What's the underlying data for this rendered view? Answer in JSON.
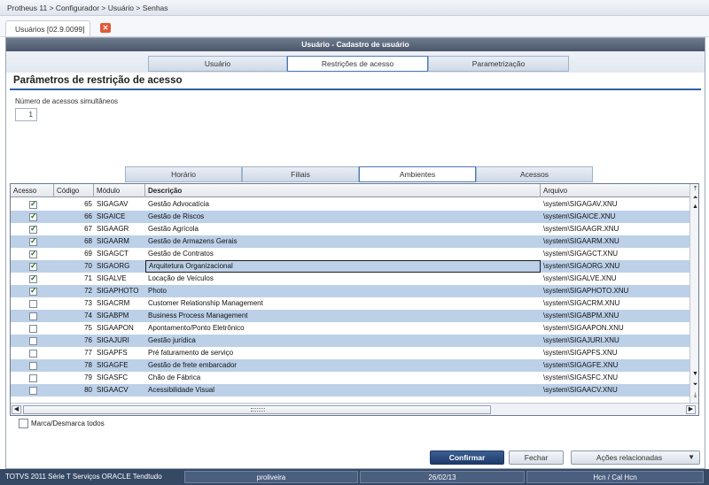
{
  "breadcrumb": "Protheus 11 > Configurador > Usuário > Senhas",
  "doc_tab": {
    "label": "Usuários [02.9.0099]",
    "close_icon": "close-icon"
  },
  "window": {
    "title": "Usuário - Cadastro de usuário"
  },
  "main_tabs": [
    {
      "label": "Usuário",
      "active": false
    },
    {
      "label": "Restrições de acesso",
      "active": true
    },
    {
      "label": "Parametrização",
      "active": false
    }
  ],
  "section": {
    "title": "Parâmetros de restrição de acesso",
    "field_label": "Número de acessos simultâneos",
    "field_value": "1"
  },
  "sub_tabs": [
    {
      "label": "Horário",
      "active": false
    },
    {
      "label": "Filiais",
      "active": false
    },
    {
      "label": "Ambientes",
      "active": true
    },
    {
      "label": "Acessos",
      "active": false
    }
  ],
  "grid": {
    "columns": [
      "Acesso",
      "Código",
      "Módulo",
      "Descrição",
      "Arquivo"
    ],
    "rows": [
      {
        "checked": true,
        "code": "65",
        "module": "SIGAGAV",
        "description": "Gestão Advocatícia",
        "file": "\\system\\SIGAGAV.XNU"
      },
      {
        "checked": true,
        "code": "66",
        "module": "SIGAICE",
        "description": "Gestão de Riscos",
        "file": "\\system\\SIGAICE.XNU"
      },
      {
        "checked": true,
        "code": "67",
        "module": "SIGAAGR",
        "description": "Gestão Agrícola",
        "file": "\\system\\SIGAAGR.XNU"
      },
      {
        "checked": true,
        "code": "68",
        "module": "SIGAARM",
        "description": "Gestão de Armazens Gerais",
        "file": "\\system\\SIGAARM.XNU"
      },
      {
        "checked": true,
        "code": "69",
        "module": "SIGAGCT",
        "description": "Gestão de Contratos",
        "file": "\\system\\SIGAGCT.XNU"
      },
      {
        "checked": true,
        "code": "70",
        "module": "SIGAORG",
        "description": "Arquitetura Organizacional",
        "file": "\\system\\SIGAORG.XNU"
      },
      {
        "checked": true,
        "code": "71",
        "module": "SIGALVE",
        "description": "Locação de Veículos",
        "file": "\\system\\SIGALVE.XNU"
      },
      {
        "checked": true,
        "code": "72",
        "module": "SIGAPHOTO",
        "description": "Photo",
        "file": "\\system\\SIGAPHOTO.XNU"
      },
      {
        "checked": false,
        "code": "73",
        "module": "SIGACRM",
        "description": "Customer Relationship Management",
        "file": "\\system\\SIGACRM.XNU"
      },
      {
        "checked": false,
        "code": "74",
        "module": "SIGABPM",
        "description": "Business Process Management",
        "file": "\\system\\SIGABPM.XNU"
      },
      {
        "checked": false,
        "code": "75",
        "module": "SIGAAPON",
        "description": "Apontamento/Ponto Eletrônico",
        "file": "\\system\\SIGAAPON.XNU"
      },
      {
        "checked": false,
        "code": "76",
        "module": "SIGAJURI",
        "description": "Gestão jurídica",
        "file": "\\system\\SIGAJURI.XNU"
      },
      {
        "checked": false,
        "code": "77",
        "module": "SIGAPFS",
        "description": "Pré faturamento de serviço",
        "file": "\\system\\SIGAPFS.XNU"
      },
      {
        "checked": false,
        "code": "78",
        "module": "SIGAGFE",
        "description": "Gestão de frete embarcador",
        "file": "\\system\\SIGAGFE.XNU"
      },
      {
        "checked": false,
        "code": "79",
        "module": "SIGASFC",
        "description": "Chão de Fábrica",
        "file": "\\system\\SIGASFC.XNU"
      },
      {
        "checked": false,
        "code": "80",
        "module": "SIGAACV",
        "description": "Acessibilidade Visual",
        "file": "\\system\\SIGAACV.XNU"
      }
    ]
  },
  "mark_all_label": "Marca/Desmarca todos",
  "buttons": {
    "confirm": "Confirmar",
    "cancel": "Fechar",
    "actions": "Ações relacionadas"
  },
  "status_bar": {
    "product": "TOTVS 2011 Série T Serviços ORACLE Tendtudo",
    "user": "proliveira",
    "date": "26/02/13",
    "extra": "Hcn / Cal Hcn"
  },
  "colors": {
    "title_bar": "#4a566a",
    "accent": "#2f5fa8",
    "row_alt": "#bcd0e8",
    "primary_button": "#1d3a68",
    "status_bar": "#354864"
  }
}
